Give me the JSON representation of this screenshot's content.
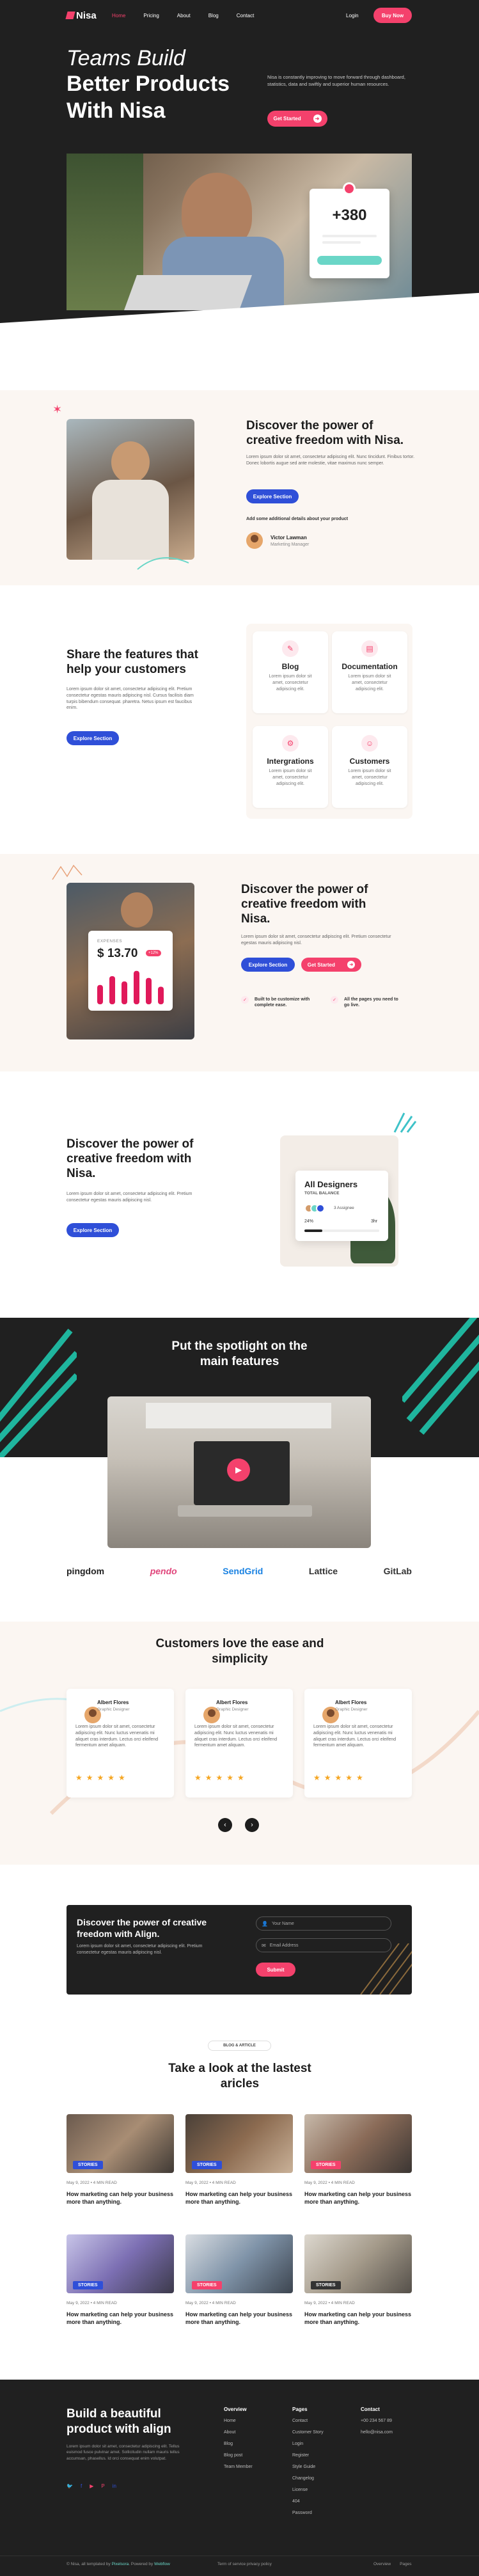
{
  "nav": {
    "logo": "Nisa",
    "links": [
      "Home",
      "Pricing",
      "About",
      "Blog",
      "Contact"
    ],
    "login": "Login",
    "buy": "Buy Now"
  },
  "hero": {
    "line1": "Teams Build",
    "line2": "Better Products",
    "line3": "With Nisa",
    "desc": "Nisa is constantly improving to move forward through dashboard, statistics, data and swiftly and superior human resources.",
    "cta": "Get Started",
    "stat": "+380"
  },
  "s1": {
    "title": "Discover the power of creative freedom with Nisa.",
    "desc": "Lorem ipsum dolor sit amet, consectetur adipiscing elit. Nunc tincidunt. Finibus tortor. Donec lobortis augue sed ante molestie, vitae maximus nunc semper.",
    "cta": "Explore Section",
    "note": "Add some additional details about your product",
    "name": "Victor Lawman",
    "role": "Marketing Manager"
  },
  "s2": {
    "title": "Share the features that help your customers",
    "desc": "Lorem ipsum dolor sit amet, consectetur adipiscing elit. Pretium consectetur egestas mauris adipiscing nisl. Cursus facilisis diam turpis bibendum consequat. pharetra. Netus ipsum est faucibus enim.",
    "cta": "Explore Section",
    "cards": [
      {
        "title": "Blog",
        "desc": "Lorem ipsum dolor sit amet, consectetur adipiscing elit."
      },
      {
        "title": "Documentation",
        "desc": "Lorem ipsum dolor sit amet, consectetur adipiscing elit."
      },
      {
        "title": "Intergrations",
        "desc": "Lorem ipsum dolor sit amet, consectetur adipiscing elit."
      },
      {
        "title": "Customers",
        "desc": "Lorem ipsum dolor sit amet, consectetur adipiscing elit."
      }
    ]
  },
  "s3": {
    "title": "Discover the power of creative freedom with Nisa.",
    "desc": "Lorem ipsum dolor sit amet, consectetur adipiscing elit. Pretium consectetur egestas mauris adipiscing nisl.",
    "cta1": "Explore Section",
    "cta2": "Get Started",
    "b1": "Built to be customize with complete ease.",
    "b2": "All the pages you need to go live.",
    "exp_label": "EXPENSES",
    "exp_value": "$ 13.70",
    "exp_badge": "+12%",
    "bars": [
      0.55,
      0.8,
      0.65,
      0.95,
      0.75,
      0.5
    ]
  },
  "s4": {
    "title": "Discover the power of creative freedom with Nisa.",
    "desc": "Lorem ipsum dolor sit amet, consectetur adipiscing elit. Pretium consectetur egestas mauris adipiscing nisl.",
    "cta": "Explore Section",
    "card_title": "All Designers",
    "card_sub": "TOTAL BALANCE",
    "assign": "3 Assignee",
    "p1": "24%",
    "p2": "3hr"
  },
  "s5": {
    "title": "Put the spotlight on the main features",
    "logos": [
      "pingdom",
      "pendo",
      "SendGrid",
      "Lattice",
      "GitLab"
    ]
  },
  "s6": {
    "title": "Customers love the ease and simplicity",
    "cards": [
      {
        "name": "Albert Flores",
        "role": "Graphic Designer",
        "text": "Lorem ipsum dolor sit amet, consectetur adipiscing elit. Nunc luctus venenatis mi aliquet cras interdum. Lectus orci eleifend fermentum amet aliquam."
      },
      {
        "name": "Albert Flores",
        "role": "Graphic Designer",
        "text": "Lorem ipsum dolor sit amet, consectetur adipiscing elit. Nunc luctus venenatis mi aliquet cras interdum. Lectus orci eleifend fermentum amet aliquam."
      },
      {
        "name": "Albert Flores",
        "role": "Graphic Designer",
        "text": "Lorem ipsum dolor sit amet, consectetur adipiscing elit. Nunc luctus venenatis mi aliquet cras interdum. Lectus orci eleifend fermentum amet aliquam."
      }
    ],
    "stars": "★★★★★"
  },
  "s7": {
    "title": "Discover the power of creative freedom with Align.",
    "desc": "Lorem ipsum dolor sit amet, consectetur adipiscing elit. Pretium consectetur egestas mauris adipiscing nisl.",
    "name_ph": "Your Name",
    "email_ph": "Email Address",
    "submit": "Submit"
  },
  "s8": {
    "eyebrow": "BLOG & ARTICLE",
    "title": "Take a look at the lastest aricles",
    "posts": [
      {
        "tag": "STORIES",
        "tagColor": "#2f4fd8",
        "meta": "May 9, 2022 • 4 MIN READ",
        "title": "How marketing can help your business more than anything."
      },
      {
        "tag": "STORIES",
        "tagColor": "#2f4fd8",
        "meta": "May 9, 2022 • 4 MIN READ",
        "title": "How marketing can help your business more than anything."
      },
      {
        "tag": "STORIES",
        "tagColor": "#f4416c",
        "meta": "May 9, 2022 • 4 MIN READ",
        "title": "How marketing can help your business more than anything."
      },
      {
        "tag": "STORIES",
        "tagColor": "#2f4fd8",
        "meta": "May 9, 2022 • 4 MIN READ",
        "title": "How marketing can help your business more than anything."
      },
      {
        "tag": "STORIES",
        "tagColor": "#f4416c",
        "meta": "May 9, 2022 • 4 MIN READ",
        "title": "How marketing can help your business more than anything."
      },
      {
        "tag": "STORIES",
        "tagColor": "#333333",
        "meta": "May 9, 2022 • 4 MIN READ",
        "title": "How marketing can help your business more than anything."
      }
    ]
  },
  "footer": {
    "title": "Build a beautiful product with align",
    "desc": "Lorem ipsum dolor sit amet, consectetur adipiscing elit. Tellus euismod fusce pulvinar amet. Sollicitudin nullam mauris tellus accumsan, phasellus. Id orci consequat enim volutpat.",
    "col1": {
      "title": "Overview",
      "items": [
        "Home",
        "About",
        "Blog",
        "Blog post",
        "Team Member"
      ]
    },
    "col2": {
      "title": "Pages",
      "items": [
        "Contact",
        "Customer Story",
        "Login",
        "Register",
        "Style Guide",
        "Changelog",
        "License",
        "404",
        "Password"
      ]
    },
    "col3": {
      "title": "Contact",
      "items": [
        "+00 234 567 89",
        "hello@nisa.com"
      ]
    },
    "copy_a": "© Nisa, all templated by",
    "copy_b": "Pixelsora",
    "copy_c": ". Powered by",
    "copy_d": "Webflow",
    "terms": "Term of service privacy policy",
    "links": [
      "Overview",
      "Pages"
    ]
  }
}
